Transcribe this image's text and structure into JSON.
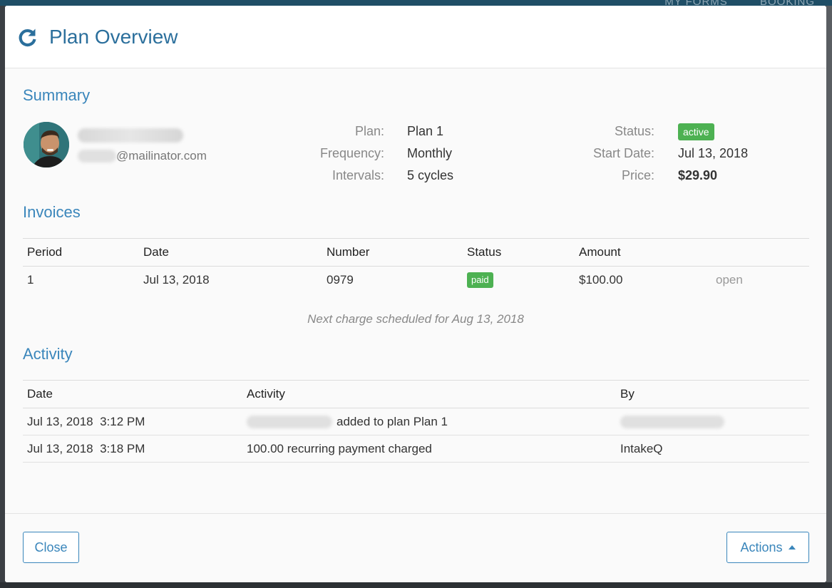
{
  "backdrop": {
    "nav_items": [
      "MY FORMS",
      "BOOKING"
    ]
  },
  "modal": {
    "title": "Plan Overview",
    "refresh_icon": "refresh-icon"
  },
  "summary": {
    "title": "Summary",
    "email_domain": "@mailinator.com",
    "plan_label": "Plan:",
    "plan_value": "Plan 1",
    "frequency_label": "Frequency:",
    "frequency_value": "Monthly",
    "intervals_label": "Intervals:",
    "intervals_value": "5 cycles",
    "status_label": "Status:",
    "status_value": "active",
    "start_label": "Start Date:",
    "start_value": "Jul 13, 2018",
    "price_label": "Price:",
    "price_value": "$29.90"
  },
  "invoices": {
    "title": "Invoices",
    "headers": [
      "Period",
      "Date",
      "Number",
      "Status",
      "Amount"
    ],
    "rows": [
      {
        "period": "1",
        "date": "Jul 13, 2018",
        "number": "0979",
        "status": "paid",
        "amount": "$100.00",
        "action": "open"
      }
    ],
    "next_charge": "Next charge scheduled for Aug 13, 2018"
  },
  "activity": {
    "title": "Activity",
    "headers": [
      "Date",
      "Activity",
      "By"
    ],
    "rows": [
      {
        "date": "Jul 13, 2018  3:12 PM",
        "activity": "added to plan Plan 1",
        "by": ""
      },
      {
        "date": "Jul 13, 2018  3:18 PM",
        "activity": "100.00 recurring payment charged",
        "by": "IntakeQ"
      }
    ]
  },
  "footer": {
    "close_label": "Close",
    "actions_label": "Actions"
  },
  "colors": {
    "accent": "#3a86bb",
    "title": "#2b6f9c",
    "badge_green": "#4db152"
  }
}
